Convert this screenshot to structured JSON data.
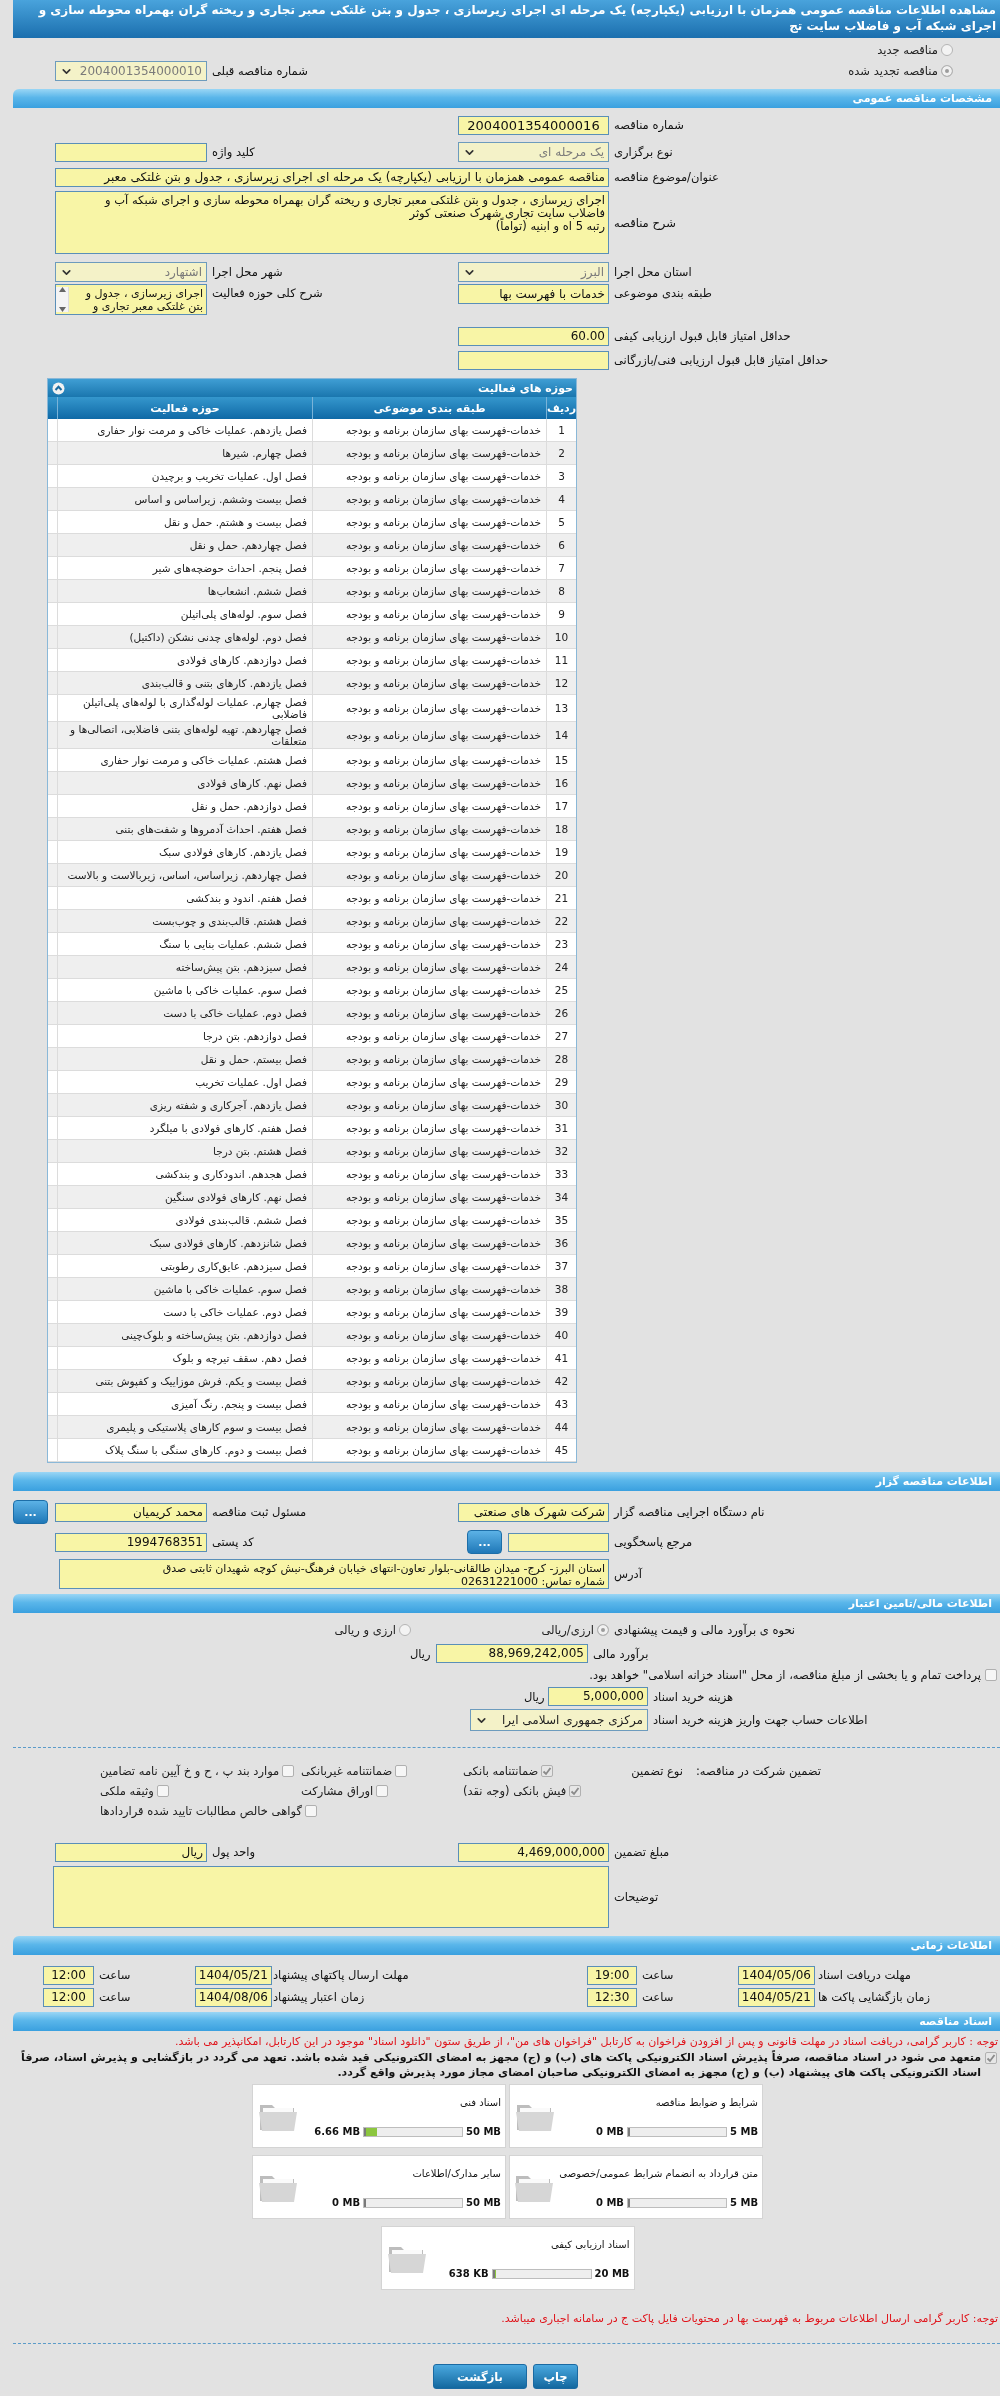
{
  "page_title": "مشاهده اطلاعات مناقصه عمومی همزمان با ارزیابی (یکپارچه) یک مرحله ای اجرای زیرسازی ، جدول و بتن غلتکی معبر تجاری و ریخته گران بهمراه محوطه سازی و اجرای شبکه آب و فاضلاب سایت تج",
  "tender_kind": [
    {
      "label": "مناقصه جدید",
      "selected": false
    },
    {
      "label": "مناقصه تجدید شده",
      "selected": true
    }
  ],
  "previous_tender": {
    "label": "شماره مناقصه قبلی",
    "value": "2004001354000010"
  },
  "general": {
    "title": "مشخصات مناقصه عمومی",
    "tender_number": {
      "label": "شماره مناقصه",
      "value": "2004001354000016"
    },
    "holding_type": {
      "label": "نوع برگزاری",
      "value": "یک مرحله ای"
    },
    "keyword": {
      "label": "کلید واژه"
    },
    "subject": {
      "label": "عنوان/موضوع مناقصه",
      "value": "مناقصه عمومی همزمان با ارزیابی (یکپارچه) یک مرحله ای اجرای زیرسازی ، جدول و بتن غلتکی معبر"
    },
    "description": {
      "label": "شرح مناقصه",
      "lines": [
        "اجرای زیرسازی ، جدول و بتن غلتکی معبر تجاری و ریخته گران بهمراه محوطه سازی و اجرای شبکه آب و",
        "فاضلاب سایت تجاری شهرک صنعتی کوثر",
        "رتبه 5 اه و ابنیه (تواماً)"
      ]
    },
    "province": {
      "label": "استان محل اجرا",
      "value": "البرز"
    },
    "city": {
      "label": "شهر محل اجرا",
      "value": "اشتهارد"
    },
    "category": {
      "label": "طبقه بندی موضوعی",
      "value": "خدمات با فهرست بها"
    },
    "activity_summary": {
      "label": "شرح کلی حوزه فعالیت",
      "lines": [
        "اجرای زیرسازی ، جدول و",
        "بتن غلتکی معبر تجاری و"
      ]
    },
    "min_quality_score": {
      "label": "حداقل امتیاز قابل قبول ارزیابی کیفی",
      "value": "60.00"
    },
    "min_technical_score": {
      "label": "حداقل امتیاز قابل قبول ارزیابی فنی/بازرگانی"
    }
  },
  "activities": {
    "title": "حوزه های فعالیت",
    "columns": [
      "ردیف",
      "طبقه بندی موضوعی",
      "حوزه فعالیت"
    ],
    "rows": [
      {
        "index": "1",
        "category": "خدمات-فهرست بهای سازمان برنامه و بودجه",
        "activity": "فصل یازدهم. عملیات خاکی و مرمت نوار حفاری"
      },
      {
        "index": "2",
        "category": "خدمات-فهرست بهای سازمان برنامه و بودجه",
        "activity": "فصل چهارم. شیرها"
      },
      {
        "index": "3",
        "category": "خدمات-فهرست بهای سازمان برنامه و بودجه",
        "activity": "فصل اول. عملیات تخریب و برچیدن"
      },
      {
        "index": "4",
        "category": "خدمات-فهرست بهای سازمان برنامه و بودجه",
        "activity": "فصل بیست وششم. زیراساس و اساس"
      },
      {
        "index": "5",
        "category": "خدمات-فهرست بهای سازمان برنامه و بودجه",
        "activity": "فصل بیست و هشتم. حمل و نقل"
      },
      {
        "index": "6",
        "category": "خدمات-فهرست بهای سازمان برنامه و بودجه",
        "activity": "فصل چهاردهم. حمل و نقل"
      },
      {
        "index": "7",
        "category": "خدمات-فهرست بهای سازمان برنامه و بودجه",
        "activity": "فصل پنجم. احداث حوضچه‌های شیر"
      },
      {
        "index": "8",
        "category": "خدمات-فهرست بهای سازمان برنامه و بودجه",
        "activity": "فصل ششم. انشعاب‌ها"
      },
      {
        "index": "9",
        "category": "خدمات-فهرست بهای سازمان برنامه و بودجه",
        "activity": "فصل سوم. لوله‌های پلی‌اتیلن"
      },
      {
        "index": "10",
        "category": "خدمات-فهرست بهای سازمان برنامه و بودجه",
        "activity": "فصل دوم. لوله‌های چدنی نشکن (داکتیل)"
      },
      {
        "index": "11",
        "category": "خدمات-فهرست بهای سازمان برنامه و بودجه",
        "activity": "فصل دوازدهم. کارهای فولادی"
      },
      {
        "index": "12",
        "category": "خدمات-فهرست بهای سازمان برنامه و بودجه",
        "activity": "فصل یازدهم. کارهای بتنی و قالب‌بندی"
      },
      {
        "index": "13",
        "category": "خدمات-فهرست بهای سازمان برنامه و بودجه",
        "activity": "فصل چهارم. عملیات لوله‌گذاری با لوله‌های پلی‌اتیلن فاضلابی"
      },
      {
        "index": "14",
        "category": "خدمات-فهرست بهای سازمان برنامه و بودجه",
        "activity": "فصل چهاردهم. تهیه لوله‌های بتنی فاضلابی، اتصالی‌ها و متعلقات"
      },
      {
        "index": "15",
        "category": "خدمات-فهرست بهای سازمان برنامه و بودجه",
        "activity": "فصل هشتم. عملیات خاکی و مرمت نوار حفاری"
      },
      {
        "index": "16",
        "category": "خدمات-فهرست بهای سازمان برنامه و بودجه",
        "activity": "فصل نهم. کارهای فولادی"
      },
      {
        "index": "17",
        "category": "خدمات-فهرست بهای سازمان برنامه و بودجه",
        "activity": "فصل دوازدهم. حمل و نقل"
      },
      {
        "index": "18",
        "category": "خدمات-فهرست بهای سازمان برنامه و بودجه",
        "activity": "فصل هفتم. احداث آدمروها و شفت‌های بتنی"
      },
      {
        "index": "19",
        "category": "خدمات-فهرست بهای سازمان برنامه و بودجه",
        "activity": "فصل یازدهم. کارهای فولادی سبک"
      },
      {
        "index": "20",
        "category": "خدمات-فهرست بهای سازمان برنامه و بودجه",
        "activity": "فصل چهاردهم. زیراساس، اساس، زیربالاست و بالاست"
      },
      {
        "index": "21",
        "category": "خدمات-فهرست بهای سازمان برنامه و بودجه",
        "activity": "فصل هفتم. اندود و بندکشی"
      },
      {
        "index": "22",
        "category": "خدمات-فهرست بهای سازمان برنامه و بودجه",
        "activity": "فصل هشتم. قالب‌بندی و چوب‌بست"
      },
      {
        "index": "23",
        "category": "خدمات-فهرست بهای سازمان برنامه و بودجه",
        "activity": "فصل ششم. عملیات بنایی با سنگ"
      },
      {
        "index": "24",
        "category": "خدمات-فهرست بهای سازمان برنامه و بودجه",
        "activity": "فصل سیزدهم. بتن پیش‌ساخته"
      },
      {
        "index": "25",
        "category": "خدمات-فهرست بهای سازمان برنامه و بودجه",
        "activity": "فصل سوم. عملیات خاکی با ماشین"
      },
      {
        "index": "26",
        "category": "خدمات-فهرست بهای سازمان برنامه و بودجه",
        "activity": "فصل دوم. عملیات خاکی با دست"
      },
      {
        "index": "27",
        "category": "خدمات-فهرست بهای سازمان برنامه و بودجه",
        "activity": "فصل دوازدهم. بتن درجا"
      },
      {
        "index": "28",
        "category": "خدمات-فهرست بهای سازمان برنامه و بودجه",
        "activity": "فصل بیستم. حمل و نقل"
      },
      {
        "index": "29",
        "category": "خدمات-فهرست بهای سازمان برنامه و بودجه",
        "activity": "فصل اول. عملیات تخریب"
      },
      {
        "index": "30",
        "category": "خدمات-فهرست بهای سازمان برنامه و بودجه",
        "activity": "فصل یازدهم. آجرکاری و شفته ریزی"
      },
      {
        "index": "31",
        "category": "خدمات-فهرست بهای سازمان برنامه و بودجه",
        "activity": "فصل هفتم. کارهای فولادی با میلگرد"
      },
      {
        "index": "32",
        "category": "خدمات-فهرست بهای سازمان برنامه و بودجه",
        "activity": "فصل هشتم. بتن درجا"
      },
      {
        "index": "33",
        "category": "خدمات-فهرست بهای سازمان برنامه و بودجه",
        "activity": "فصل هجدهم. اندودکاری و بندکشی"
      },
      {
        "index": "34",
        "category": "خدمات-فهرست بهای سازمان برنامه و بودجه",
        "activity": "فصل نهم. کارهای فولادی سنگین"
      },
      {
        "index": "35",
        "category": "خدمات-فهرست بهای سازمان برنامه و بودجه",
        "activity": "فصل ششم. قالب‌بندی فولادی"
      },
      {
        "index": "36",
        "category": "خدمات-فهرست بهای سازمان برنامه و بودجه",
        "activity": "فصل شانزدهم. کارهای فولادی سبک"
      },
      {
        "index": "37",
        "category": "خدمات-فهرست بهای سازمان برنامه و بودجه",
        "activity": "فصل سیزدهم. عایق‌کاری رطوبتی"
      },
      {
        "index": "38",
        "category": "خدمات-فهرست بهای سازمان برنامه و بودجه",
        "activity": "فصل سوم. عملیات خاکی با ماشین"
      },
      {
        "index": "39",
        "category": "خدمات-فهرست بهای سازمان برنامه و بودجه",
        "activity": "فصل دوم. عملیات خاکی با دست"
      },
      {
        "index": "40",
        "category": "خدمات-فهرست بهای سازمان برنامه و بودجه",
        "activity": "فصل دوازدهم. بتن پیش‌ساخته و بلوک‌چینی"
      },
      {
        "index": "41",
        "category": "خدمات-فهرست بهای سازمان برنامه و بودجه",
        "activity": "فصل دهم. سقف تیرچه و بلوک"
      },
      {
        "index": "42",
        "category": "خدمات-فهرست بهای سازمان برنامه و بودجه",
        "activity": "فصل بیست و یکم. فرش موزاییک و کفپوش بتنی"
      },
      {
        "index": "43",
        "category": "خدمات-فهرست بهای سازمان برنامه و بودجه",
        "activity": "فصل بیست و پنجم. رنگ آمیزی"
      },
      {
        "index": "44",
        "category": "خدمات-فهرست بهای سازمان برنامه و بودجه",
        "activity": "فصل بیست و سوم کارهای پلاستیکی و پلیمری"
      },
      {
        "index": "45",
        "category": "خدمات-فهرست بهای سازمان برنامه و بودجه",
        "activity": "فصل بیست و دوم. کارهای سنگی با سنگ پلاک"
      }
    ]
  },
  "organizer": {
    "title": "اطلاعات مناقصه گزار",
    "agency": {
      "label": "نام دستگاه اجرایی مناقصه گزار",
      "value": "شرکت شهرک های صنعتی"
    },
    "registrar": {
      "label": "مسئول ثبت مناقصه",
      "value": "محمد کریمیان",
      "button": "..."
    },
    "reference": {
      "label": "مرجع پاسخگویی",
      "button": "..."
    },
    "postal_code": {
      "label": "کد پستی",
      "value": "1994768351"
    },
    "address": {
      "label": "آدرس",
      "lines": [
        "استان البرز- کرج- میدان طالقانی-بلوار تعاون-انتهای خیابان فرهنگ-نبش کوچه شهیدان ثابتی صدق",
        "شماره تماس: 02631221000"
      ]
    }
  },
  "finance": {
    "title": "اطلاعات مالی/تامین اعتبار",
    "estimate_method": {
      "label": "نحوه ی برآورد مالی و قیمت پیشنهادی",
      "options": [
        {
          "label": "ارزی/ریالی",
          "selected": true
        },
        {
          "label": "ارزی و ریالی",
          "selected": false
        }
      ]
    },
    "estimate": {
      "label": "برآورد مالی",
      "value": "88,969,242,005",
      "unit": "ریال"
    },
    "treasury_payment": {
      "label": "پرداخت تمام و یا بخشی از مبلغ مناقصه، از محل \"اسناد خزانه اسلامی\" خواهد بود.",
      "checked": false
    },
    "document_fee": {
      "label": "هزینه خرید اسناد",
      "value": "5,000,000",
      "unit": "ریال"
    },
    "fee_account": {
      "label": "اطلاعات حساب جهت واریز هزینه خرید اسناد",
      "value": "مرکزی جمهوری اسلامی ایرا"
    },
    "guarantee": {
      "title": "تضمین شرکت در مناقصه:",
      "type_label": "نوع تضمین",
      "options": [
        {
          "label": "ضمانتنامه بانکی",
          "checked": true
        },
        {
          "label": "ضمانتنامه غیربانکی",
          "checked": false
        },
        {
          "label": "موارد بند پ ، ح و خ آیین نامه تضامین",
          "checked": false
        },
        {
          "label": "فیش بانکی (وجه نقد)",
          "checked": true
        },
        {
          "label": "اوراق مشارکت",
          "checked": false
        },
        {
          "label": "وثیقه ملکی",
          "checked": false
        },
        {
          "label": "گواهی خالص مطالبات تایید شده قراردادها",
          "checked": false
        }
      ]
    },
    "guarantee_amount": {
      "label": "مبلغ تضمین",
      "value": "4,469,000,000"
    },
    "currency": {
      "label": "واحد پول",
      "value": "ریال"
    },
    "notes": {
      "label": "توضیحات"
    }
  },
  "timing": {
    "title": "اطلاعات زمانی",
    "items": [
      {
        "label": "مهلت دریافت اسناد",
        "date": "1404/05/06",
        "time_label": "ساعت",
        "time": "19:00"
      },
      {
        "label": "مهلت ارسال پاکتهای پیشنهاد",
        "date": "1404/05/21",
        "time_label": "ساعت",
        "time": "12:00"
      },
      {
        "label": "زمان بازگشایی پاکت ها",
        "date": "1404/05/21",
        "time_label": "ساعت",
        "time": "12:30"
      },
      {
        "label": "زمان اعتبار پیشنهاد",
        "date": "1404/08/06",
        "time_label": "ساعت",
        "time": "12:00"
      }
    ]
  },
  "documents": {
    "title": "اسناد مناقصه",
    "notice": "توجه : کاربر گرامی، دریافت اسناد در مهلت قانونی و پس از افزودن فراخوان به کارتابل \"فراخوان های من\"، از طریق ستون \"دانلود اسناد\" موجود در این کارتابل، امکانپذیر می باشد.",
    "commitment": {
      "text": "متعهد می شود در اسناد مناقصه، صرفاً پذیرش اسناد الکترونیکی پاکت های (ب) و (ج) مجهز به امضای الکترونیکی قید شده باشد. تعهد می گردد در بازگشایی و پذیرش اسناد، صرفاً اسناد الکترونیکی پاکت های پیشنهاد (ب) و (ج) مجهز به امضای الکترونیکی صاحبان امضای مجاز مورد پذیرش واقع گردد.",
      "checked": true
    },
    "files": [
      {
        "name": "شرایط و ضوابط مناقصه",
        "max": "5 MB",
        "size": "0 MB",
        "level": 0
      },
      {
        "name": "اسناد فنی",
        "max": "50 MB",
        "size": "6.66 MB",
        "level": 0.133
      },
      {
        "name": "متن قرارداد به انضمام شرایط عمومی/خصوصی",
        "max": "5 MB",
        "size": "0 MB",
        "level": 0
      },
      {
        "name": "سایر مدارک/اطلاعات",
        "max": "50 MB",
        "size": "0 MB",
        "level": 0
      },
      {
        "name": "اسناد ارزیابی کیفی",
        "max": "20 MB",
        "size": "638 KB",
        "level": 0.031
      }
    ],
    "footer_notice": "توجه: کاربر گرامی ارسال اطلاعات مربوط به فهرست بها در محتویات فایل پاکت ج در سامانه اجباری میباشد."
  },
  "buttons": [
    {
      "label": "چاپ"
    },
    {
      "label": "بازگشت"
    }
  ]
}
